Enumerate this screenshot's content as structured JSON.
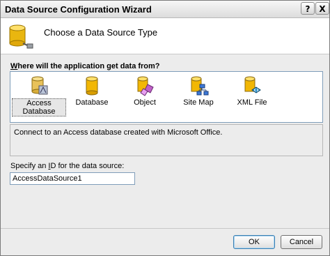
{
  "window": {
    "title": "Data Source Configuration Wizard",
    "help_glyph": "?",
    "close_glyph": "X"
  },
  "header": {
    "title": "Choose a Data Source Type"
  },
  "question": {
    "mnemonic": "W",
    "rest": "here will the application get data from?"
  },
  "types": [
    {
      "label": "Access Database",
      "icon": "access-database-icon",
      "selected": true
    },
    {
      "label": "Database",
      "icon": "database-icon",
      "selected": false
    },
    {
      "label": "Object",
      "icon": "object-icon",
      "selected": false
    },
    {
      "label": "Site Map",
      "icon": "site-map-icon",
      "selected": false
    },
    {
      "label": "XML File",
      "icon": "xml-file-icon",
      "selected": false
    }
  ],
  "description": "Connect to an Access database created with Microsoft Office.",
  "id_field": {
    "label_before": "Specify an ",
    "label_mnemonic": "I",
    "label_after": "D for the data source:",
    "value": "AccessDataSource1"
  },
  "buttons": {
    "ok": "OK",
    "cancel": "Cancel"
  }
}
